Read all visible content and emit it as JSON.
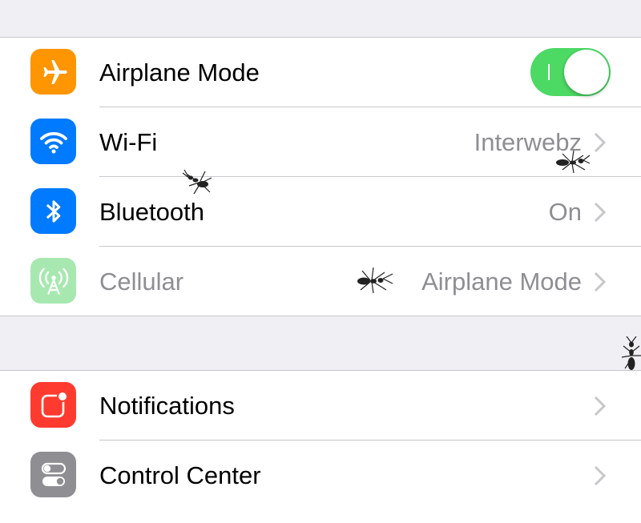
{
  "colors": {
    "background": "#efeff4",
    "switch_on": "#4cd964",
    "airplane_icon_bg": "#ff9500",
    "wifi_icon_bg": "#007aff",
    "bluetooth_icon_bg": "#007aff",
    "cellular_icon_bg": "#a7e8b1",
    "notifications_icon_bg": "#ff3b30",
    "control_center_icon_bg": "#8e8e93",
    "secondary_text": "#8e8e93"
  },
  "connectivity": {
    "airplane_mode": {
      "label": "Airplane Mode",
      "icon": "airplane-icon",
      "toggle_on": true
    },
    "wifi": {
      "label": "Wi-Fi",
      "value": "Interwebz",
      "icon": "wifi-icon"
    },
    "bluetooth": {
      "label": "Bluetooth",
      "value": "On",
      "icon": "bluetooth-icon"
    },
    "cellular": {
      "label": "Cellular",
      "value": "Airplane Mode",
      "icon": "cellular-antenna-icon",
      "disabled": true
    }
  },
  "system": {
    "notifications": {
      "label": "Notifications",
      "icon": "notifications-icon"
    },
    "control_center": {
      "label": "Control Center",
      "icon": "control-center-icon"
    }
  }
}
